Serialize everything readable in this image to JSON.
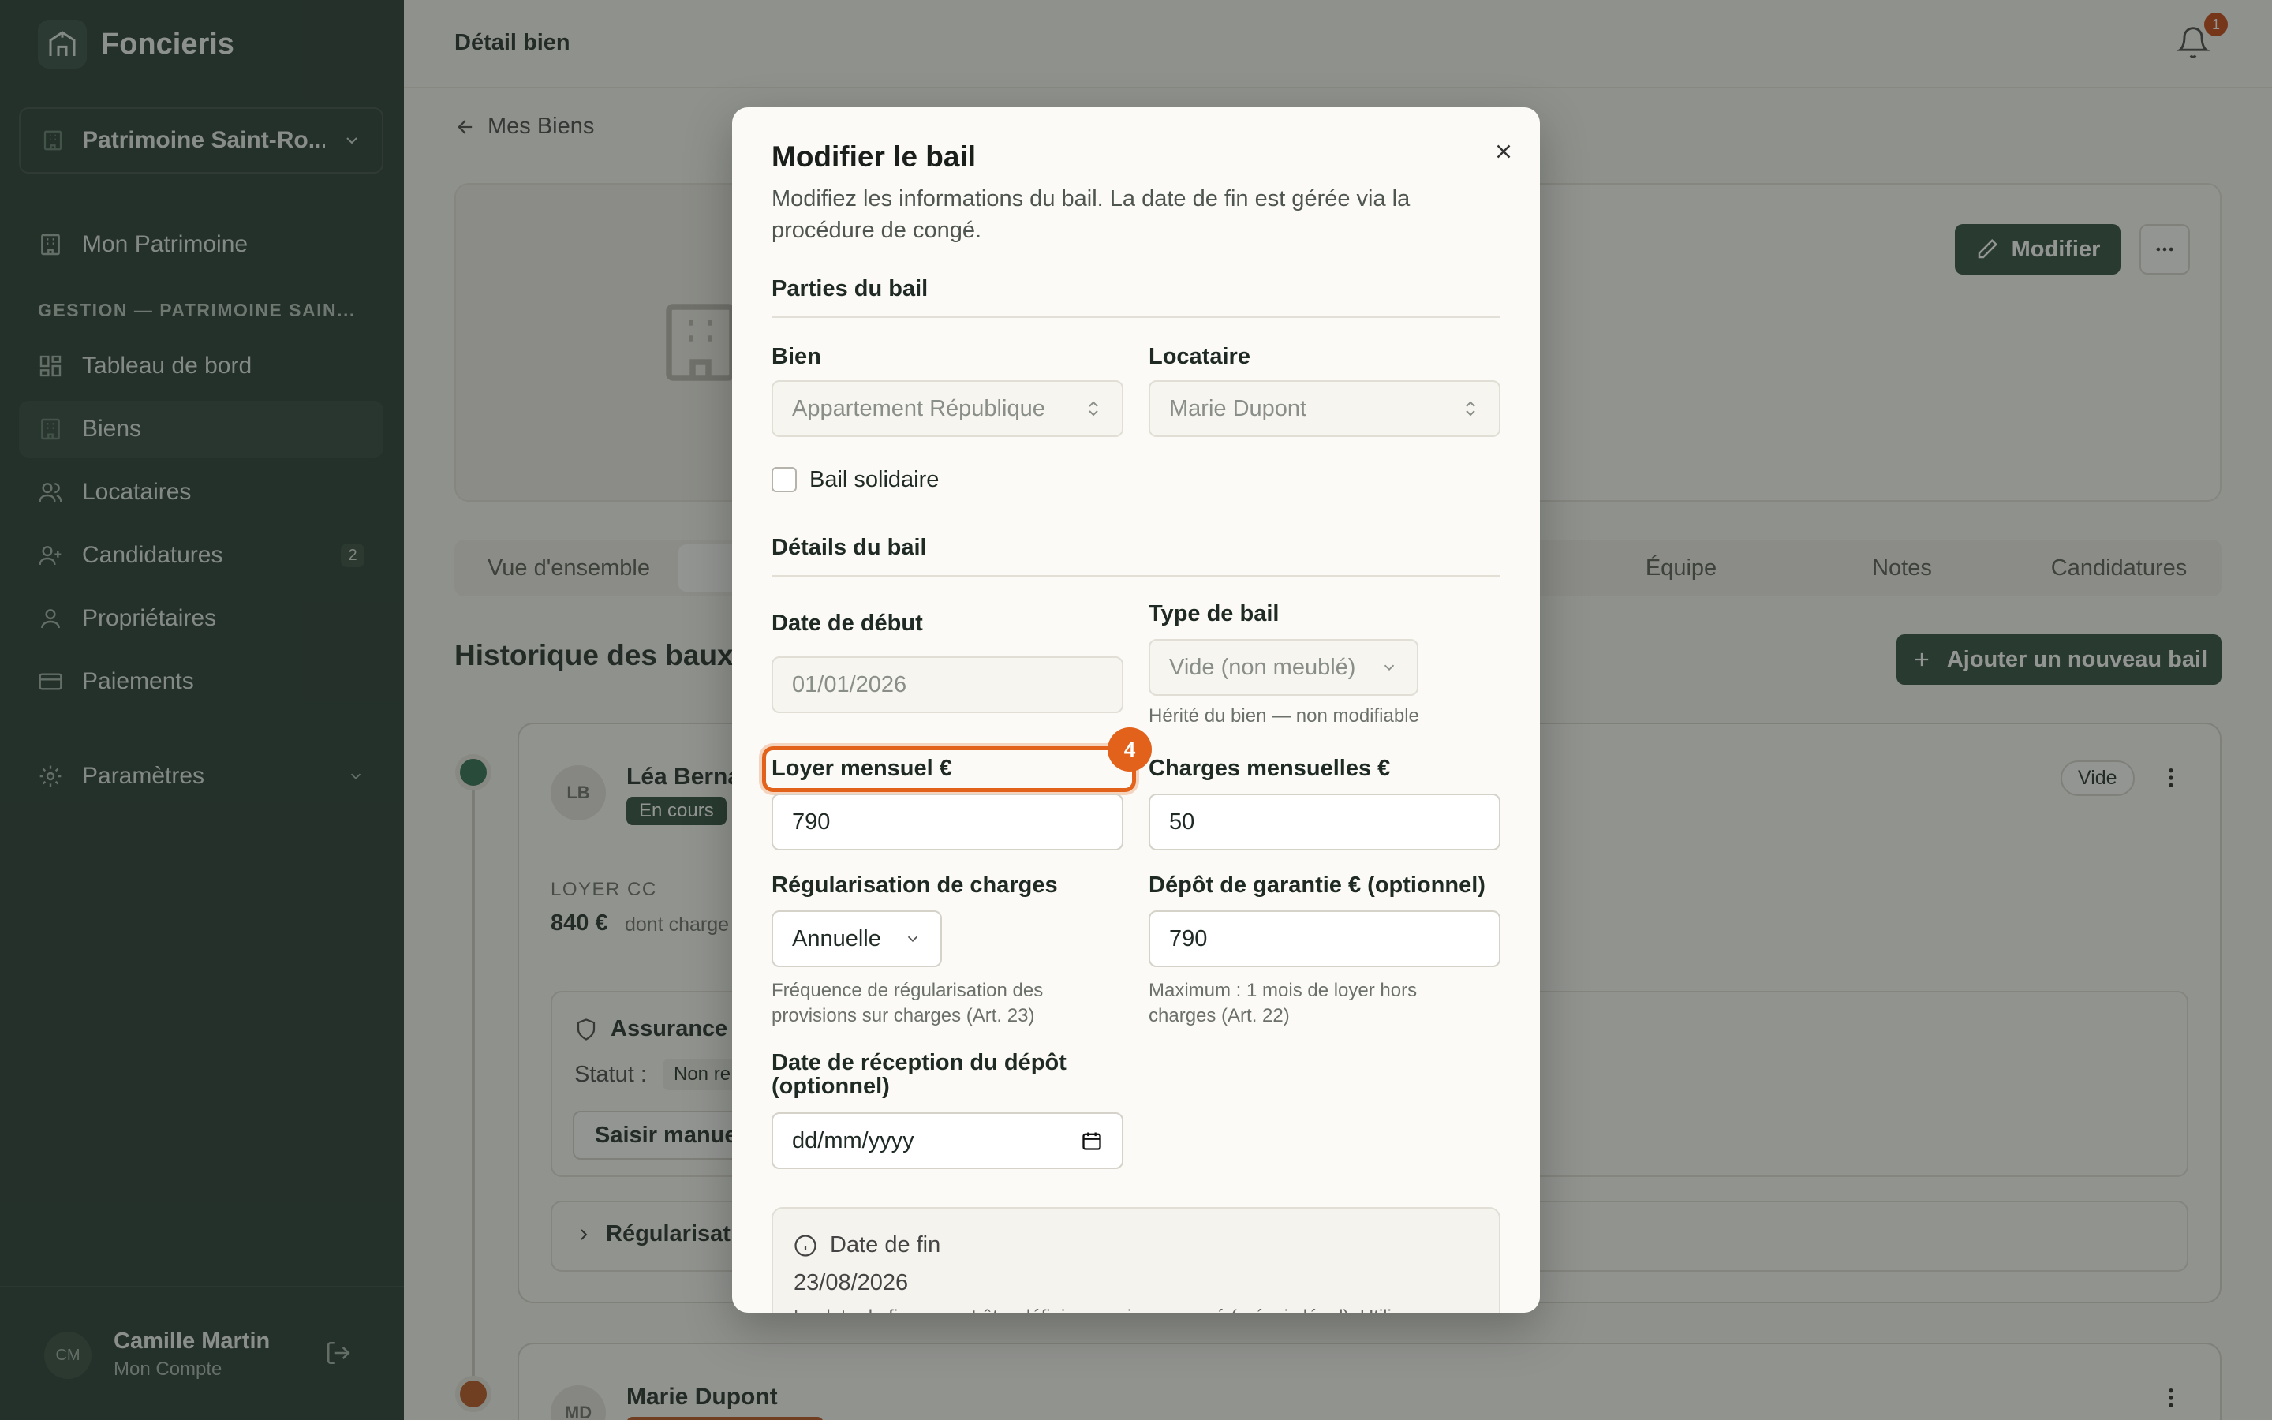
{
  "app": {
    "name": "Foncieris"
  },
  "sidebar": {
    "workspace": "Patrimoine Saint-Ro...",
    "top_item": "Mon Patrimoine",
    "section_label": "GESTION — PATRIMOINE SAIN...",
    "items": [
      {
        "label": "Tableau de bord",
        "icon": "dashboard-icon"
      },
      {
        "label": "Biens",
        "icon": "building-icon",
        "active": true
      },
      {
        "label": "Locataires",
        "icon": "users-icon"
      },
      {
        "label": "Candidatures",
        "icon": "user-plus-icon",
        "badge": "2"
      },
      {
        "label": "Propriétaires",
        "icon": "user-icon"
      },
      {
        "label": "Paiements",
        "icon": "card-icon"
      }
    ],
    "settings": "Paramètres",
    "user": {
      "initials": "CM",
      "name": "Camille Martin",
      "subtitle": "Mon Compte"
    }
  },
  "header": {
    "title": "Détail bien",
    "notifications": "1"
  },
  "page": {
    "back_link": "Mes Biens",
    "modify_button": "Modifier",
    "tabs": [
      "Vue d'ensemble",
      "Équipe",
      "Notes",
      "Candidatures"
    ],
    "section_title": "Historique des baux",
    "add_lease_button": "Ajouter un nouveau bail",
    "leases": [
      {
        "initials": "LB",
        "name": "Léa Berna",
        "status": "En cours",
        "type": "Vide",
        "rent_label": "LOYER CC",
        "rent_value": "840 €",
        "rent_sub": "dont charge",
        "insurance_title": "Assurance h",
        "status_label": "Statut :",
        "status_value": "Non re",
        "manual_button": "Saisir manuel",
        "regularisation": "Régularisati"
      },
      {
        "initials": "MD",
        "name": "Marie Dupont"
      }
    ]
  },
  "modal": {
    "title": "Modifier le bail",
    "description": "Modifiez les informations du bail. La date de fin est gérée via la procédure de congé.",
    "section_parties": "Parties du bail",
    "bien_label": "Bien",
    "bien_value": "Appartement République",
    "locataire_label": "Locataire",
    "locataire_value": "Marie Dupont",
    "bail_solidaire": "Bail solidaire",
    "section_details": "Détails du bail",
    "date_debut_label": "Date de début",
    "date_debut_value": "01/01/2026",
    "type_bail_label": "Type de bail",
    "type_bail_value": "Vide (non meublé)",
    "type_bail_help": "Hérité du bien — non modifiable",
    "loyer_label": "Loyer mensuel €",
    "loyer_value": "790",
    "charges_label": "Charges mensuelles €",
    "charges_value": "50",
    "step_badge": "4",
    "regularisation_label": "Régularisation de charges",
    "regularisation_value": "Annuelle",
    "regularisation_help": "Fréquence de régularisation des provisions sur charges (Art. 23)",
    "depot_label": "Dépôt de garantie € (optionnel)",
    "depot_value": "790",
    "depot_help": "Maximum : 1 mois de loyer hors charges (Art. 22)",
    "reception_label": "Date de réception du dépôt (optionnel)",
    "reception_placeholder": "dd/mm/yyyy",
    "end_date_label": "Date de fin",
    "end_date_value": "23/08/2026",
    "end_date_note": "La date de fin ne peut être définie que via un congé (préavis légal). Utilisez"
  }
}
